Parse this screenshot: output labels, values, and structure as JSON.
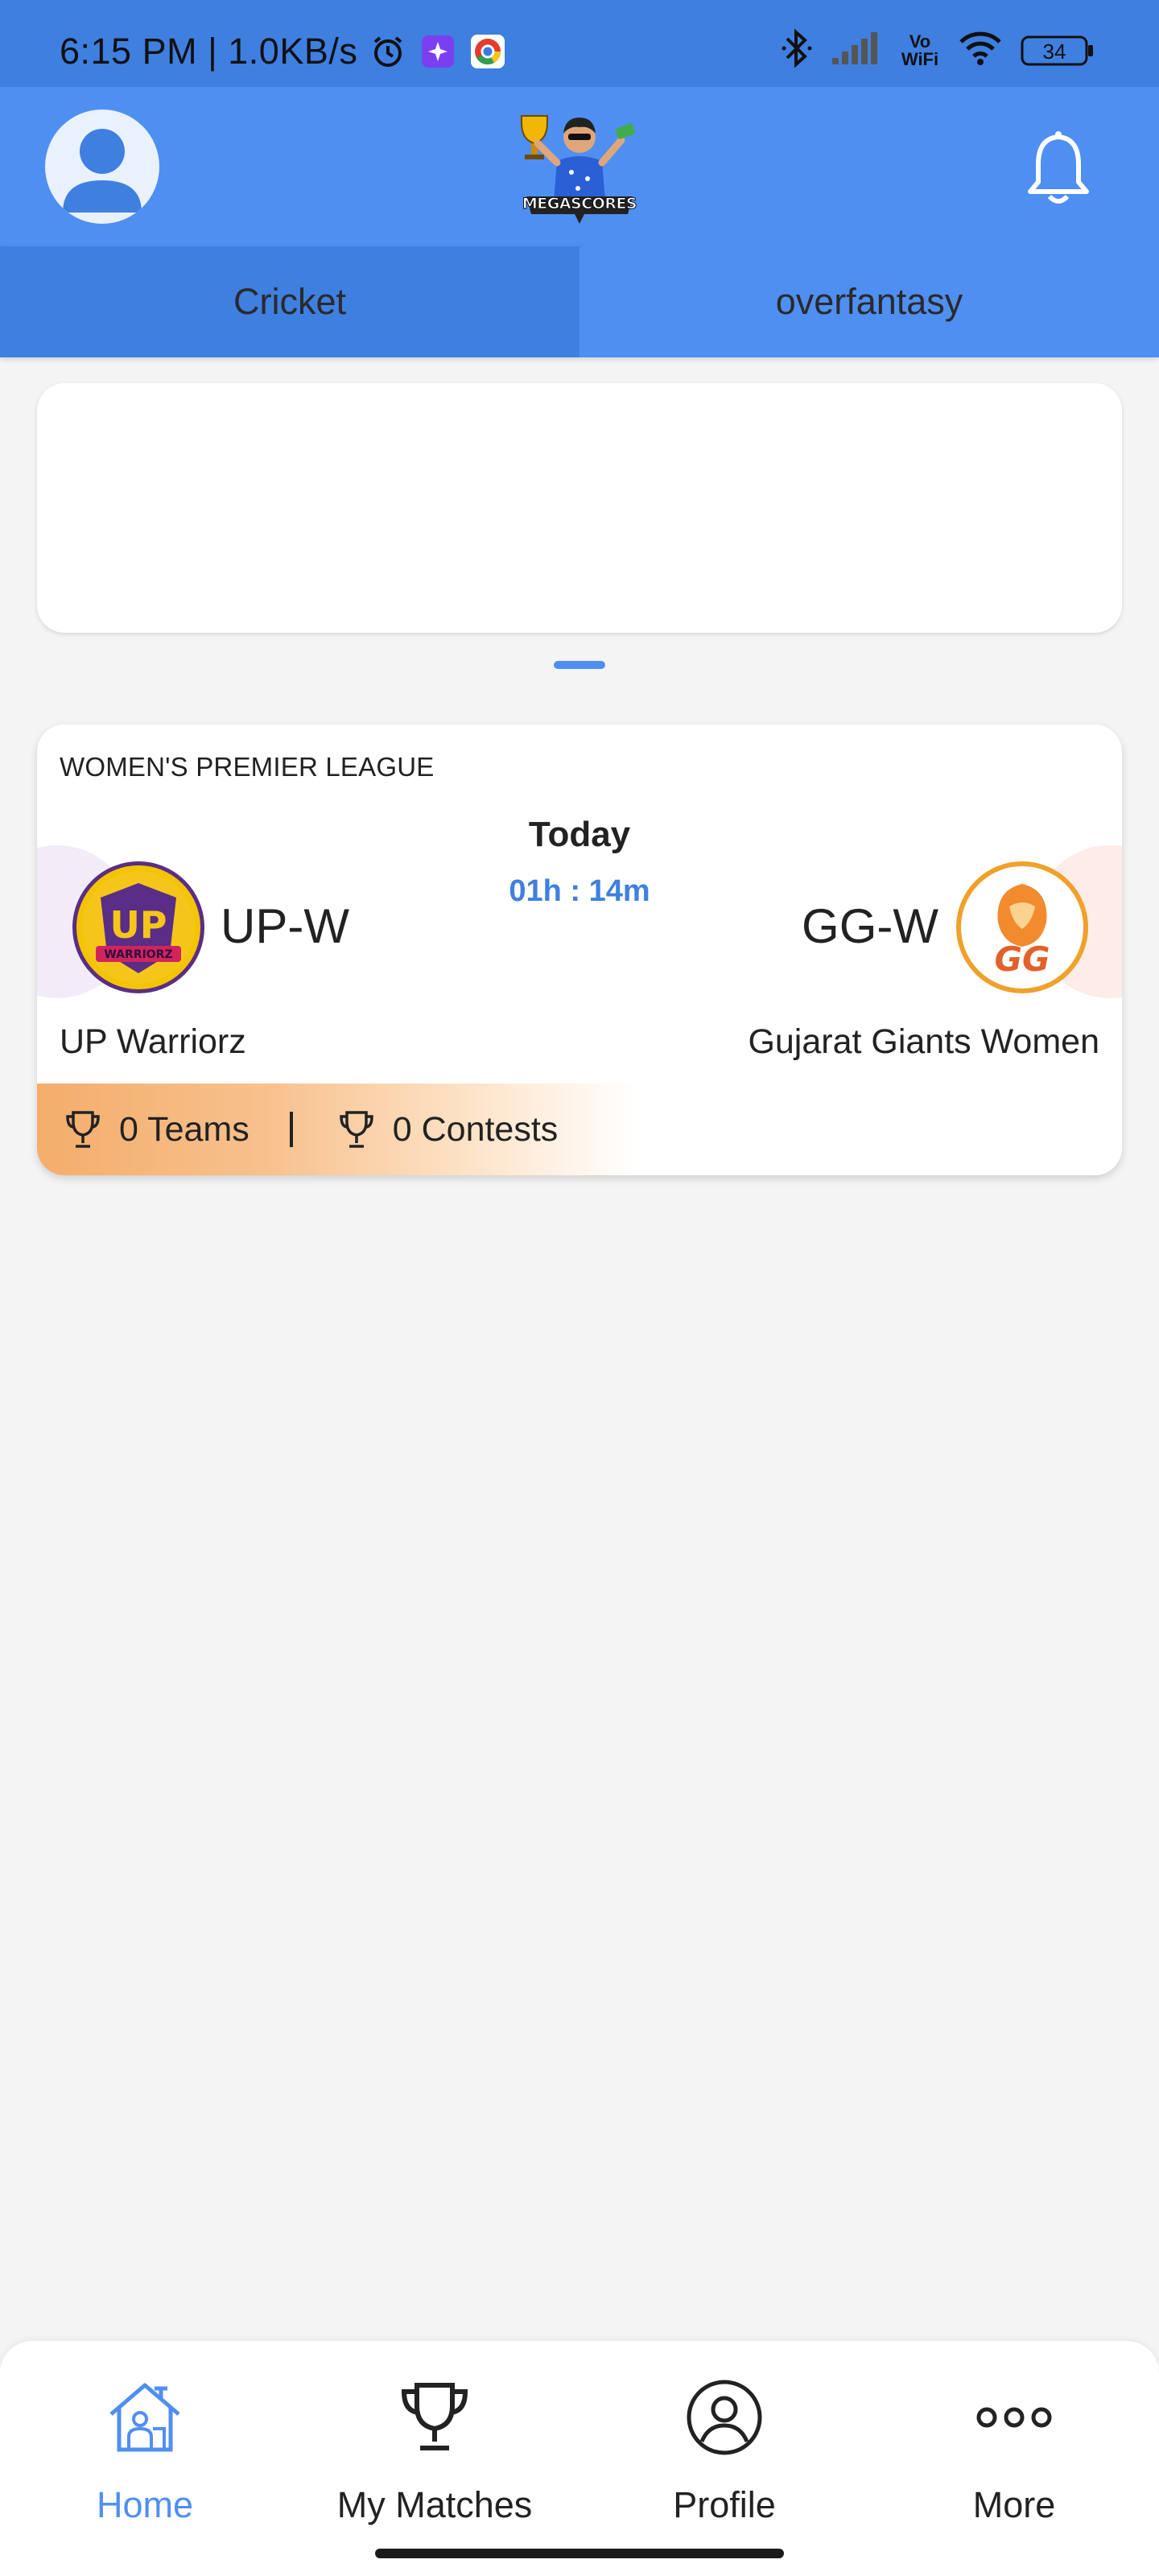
{
  "status_bar": {
    "time_speed": "6:15 PM | 1.0KB/s",
    "battery": "34",
    "icons": [
      "alarm-icon",
      "app-notification-icon",
      "chrome-icon",
      "bluetooth-icon",
      "signal-icon",
      "vowifi-icon",
      "wifi-icon",
      "battery-icon"
    ],
    "vowifi_label": "Vo WiFi"
  },
  "header": {
    "logo_text": "MEGASCORES",
    "icons": [
      "avatar-icon",
      "bell-icon"
    ]
  },
  "tabs": [
    {
      "label": "Cricket",
      "active": true
    },
    {
      "label": "overfantasy",
      "active": false
    }
  ],
  "match": {
    "league": "WOMEN'S PREMIER LEAGUE",
    "day": "Today",
    "countdown": "01h : 14m",
    "home": {
      "code": "UP-W",
      "name": "UP Warriorz",
      "logo_text": "UP",
      "logo_sub": "WARRIORZ",
      "color": "#5a2d86"
    },
    "away": {
      "code": "GG-W",
      "name": "Gujarat Giants Women",
      "logo_text": "GG",
      "color": "#f28a2e"
    },
    "teams_label": "0 Teams",
    "contests_label": "0 Contests"
  },
  "bottom_nav": [
    {
      "label": "Home",
      "icon": "home-icon",
      "active": true
    },
    {
      "label": "My Matches",
      "icon": "trophy-icon",
      "active": false
    },
    {
      "label": "Profile",
      "icon": "profile-icon",
      "active": false
    },
    {
      "label": "More",
      "icon": "more-icon",
      "active": false
    }
  ],
  "colors": {
    "primary": "#4f8ff2",
    "primary_dark": "#3f7fe0",
    "accent": "#f4ad6b"
  }
}
